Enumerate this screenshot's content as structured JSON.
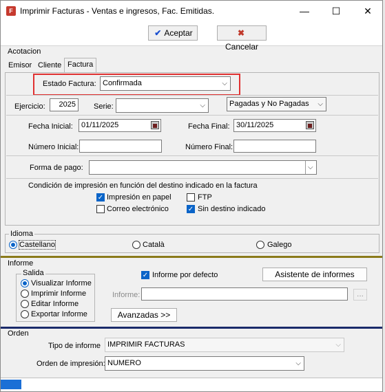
{
  "window": {
    "title": "Imprimir Facturas - Ventas e ingresos, Fac. Emitidas.",
    "minimize": "—",
    "maximize": "☐",
    "close": "✕"
  },
  "toolbar": {
    "accept_label": "Aceptar",
    "cancel_label": "Cancelar"
  },
  "acotacion": {
    "title": "Acotacion",
    "tabs": [
      "Emisor",
      "Cliente",
      "Factura"
    ],
    "estado_label": "Estado Factura:",
    "estado_value": "Confirmada",
    "ejercicio_label": "Ejercicio:",
    "ejercicio_value": "2025",
    "serie_label": "Serie:",
    "serie_value": "",
    "pagadas_value": "Pagadas y No Pagadas",
    "fecha_inicial_label": "Fecha Inicial:",
    "fecha_inicial_value": "01/11/2025",
    "fecha_final_label": "Fecha Final:",
    "fecha_final_value": "30/11/2025",
    "numero_inicial_label": "Número Inicial:",
    "numero_inicial_value": "",
    "numero_final_label": "Número Final:",
    "numero_final_value": "",
    "forma_pago_label": "Forma de pago:",
    "forma_pago_value": "",
    "condicion_text": "Condición de impresión en función del destino indicado en la factura",
    "impresion_papel": "Impresión en papel",
    "ftp": "FTP",
    "correo": "Correo electrónico",
    "sin_destino": "Sin destino indicado"
  },
  "idioma": {
    "title": "Idioma",
    "options": [
      "Castellano",
      "Català",
      "Galego"
    ]
  },
  "informe": {
    "title": "Informe",
    "salida_title": "Salida",
    "salida_options": [
      "Visualizar Informe",
      "Imprimir Informe",
      "Editar Informe",
      "Exportar Informe"
    ],
    "defecto_label": "Informe por defecto",
    "asistente_label": "Asistente de informes",
    "informe_label": "Informe:",
    "informe_value": "",
    "browse_label": "...",
    "avanzadas_label": "Avanzadas >>"
  },
  "orden": {
    "title": "Orden",
    "tipo_label": "Tipo de informe",
    "tipo_value": "IMPRIMIR FACTURAS",
    "orden_label": "Orden de impresión:",
    "orden_value": "NUMERO"
  },
  "colors": {
    "accent": "#0a64c8",
    "highlight": "#e03030",
    "divider_gold": "#8a7a1a",
    "divider_navy": "#1a2a6a"
  }
}
